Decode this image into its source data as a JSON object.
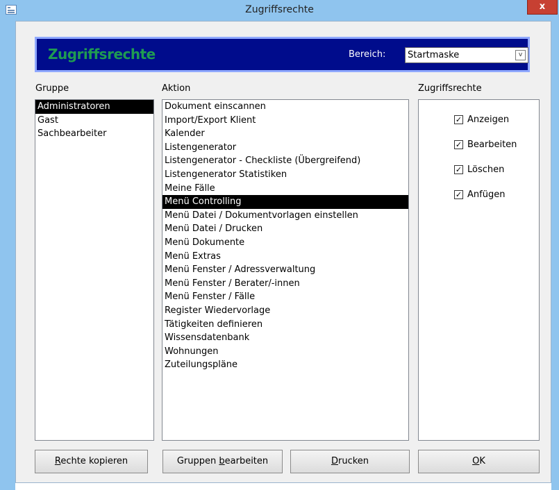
{
  "window": {
    "title": "Zugriffsrechte",
    "close_label": "x"
  },
  "header": {
    "title": "Zugriffsrechte",
    "bereich_label": "Bereich:",
    "bereich_value": "Startmaske",
    "select_arrow": "v"
  },
  "labels": {
    "gruppe": "Gruppe",
    "aktion": "Aktion",
    "zugriffsrechte": "Zugriffsrechte"
  },
  "groups": [
    {
      "label": "Administratoren",
      "selected": true
    },
    {
      "label": "Gast",
      "selected": false
    },
    {
      "label": "Sachbearbeiter",
      "selected": false
    }
  ],
  "actions": [
    {
      "label": "Dokument einscannen",
      "selected": false
    },
    {
      "label": "Import/Export Klient",
      "selected": false
    },
    {
      "label": "Kalender",
      "selected": false
    },
    {
      "label": "Listengenerator",
      "selected": false
    },
    {
      "label": "Listengenerator - Checkliste (Übergreifend)",
      "selected": false
    },
    {
      "label": "Listengenerator Statistiken",
      "selected": false
    },
    {
      "label": "Meine Fälle",
      "selected": false
    },
    {
      "label": "Menü Controlling",
      "selected": true
    },
    {
      "label": "Menü Datei / Dokumentvorlagen einstellen",
      "selected": false
    },
    {
      "label": "Menü Datei / Drucken",
      "selected": false
    },
    {
      "label": "Menü Dokumente",
      "selected": false
    },
    {
      "label": "Menü Extras",
      "selected": false
    },
    {
      "label": "Menü Fenster / Adressverwaltung",
      "selected": false
    },
    {
      "label": "Menü Fenster / Berater/-innen",
      "selected": false
    },
    {
      "label": "Menü Fenster / Fälle",
      "selected": false
    },
    {
      "label": "Register Wiedervorlage",
      "selected": false
    },
    {
      "label": "Tätigkeiten definieren",
      "selected": false
    },
    {
      "label": "Wissensdatenbank",
      "selected": false
    },
    {
      "label": "Wohnungen",
      "selected": false
    },
    {
      "label": "Zuteilungspläne",
      "selected": false
    }
  ],
  "permissions": [
    {
      "label": "Anzeigen",
      "checked": true
    },
    {
      "label": "Bearbeiten",
      "checked": true
    },
    {
      "label": "Löschen",
      "checked": true
    },
    {
      "label": "Anfügen",
      "checked": true
    }
  ],
  "checkmark": "✓",
  "buttons": {
    "rechte_kopieren": {
      "pre": "",
      "accel": "R",
      "post": "echte kopieren"
    },
    "gruppen_bearbeiten": {
      "pre": "Gruppen ",
      "accel": "b",
      "post": "earbeiten"
    },
    "drucken": {
      "pre": "",
      "accel": "D",
      "post": "rucken"
    },
    "ok": {
      "pre": "",
      "accel": "O",
      "post": "K"
    }
  }
}
